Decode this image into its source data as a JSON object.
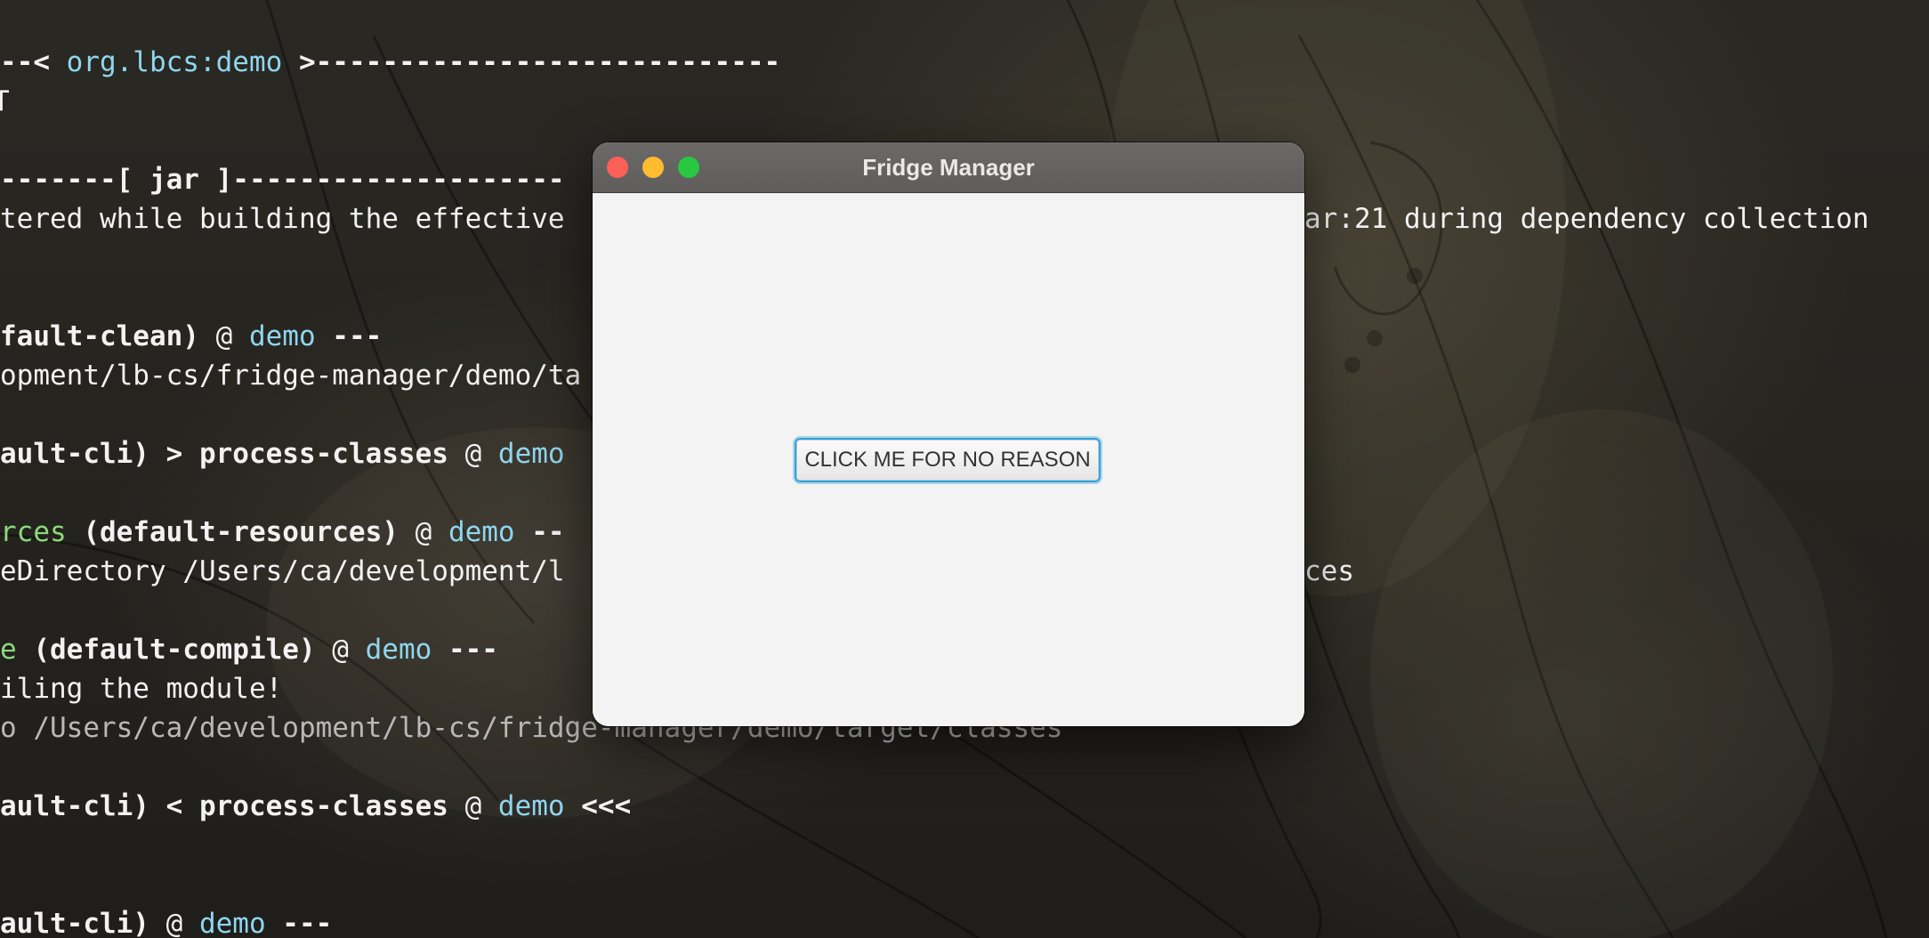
{
  "window": {
    "title": "Fridge Manager",
    "button_label": "CLICK ME FOR NO REASON"
  },
  "terminal": {
    "lines": [
      {
        "segments": [
          {
            "text": "--< ",
            "style": "b"
          },
          {
            "text": "org.lbcs:demo",
            "style": "cyan"
          },
          {
            "text": " >----------------------------",
            "style": "b"
          }
        ]
      },
      {
        "segments": [
          {
            "text": "T",
            "style": ""
          }
        ]
      },
      {
        "segments": [
          {
            "text": "-------[ jar ]--------------------",
            "style": "b"
          }
        ]
      },
      {
        "segments": [
          {
            "text": "tered while building the effective",
            "style": ""
          }
        ]
      },
      {
        "segments": [
          {
            "text": "ar:21 during dependency collection",
            "style": ""
          }
        ]
      },
      {
        "segments": [
          {
            "text": "fault-clean)",
            "style": "b"
          },
          {
            "text": " @ ",
            "style": ""
          },
          {
            "text": "demo",
            "style": "cyan"
          },
          {
            "text": " ---",
            "style": "b"
          }
        ]
      },
      {
        "segments": [
          {
            "text": "opment/lb-cs/fridge-manager/demo/ta",
            "style": ""
          }
        ]
      },
      {
        "segments": [
          {
            "text": "ault-cli) > process-classes",
            "style": "b"
          },
          {
            "text": " @ ",
            "style": ""
          },
          {
            "text": "demo",
            "style": "cyan"
          }
        ]
      },
      {
        "segments": [
          {
            "text": "rces",
            "style": "green"
          },
          {
            "text": " (default-resources)",
            "style": "b"
          },
          {
            "text": " @ ",
            "style": ""
          },
          {
            "text": "demo",
            "style": "cyan"
          },
          {
            "text": " --",
            "style": "b"
          }
        ]
      },
      {
        "segments": [
          {
            "text": "eDirectory /Users/ca/development/l",
            "style": ""
          }
        ]
      },
      {
        "segments": [
          {
            "text": "ces",
            "style": ""
          }
        ]
      },
      {
        "segments": [
          {
            "text": "e",
            "style": "green"
          },
          {
            "text": " (default-compile)",
            "style": "b"
          },
          {
            "text": " @ ",
            "style": ""
          },
          {
            "text": "demo",
            "style": "cyan"
          },
          {
            "text": " ---",
            "style": "b"
          }
        ]
      },
      {
        "segments": [
          {
            "text": "iling the module!",
            "style": ""
          }
        ]
      },
      {
        "segments": [
          {
            "text": "o /Users/ca/development/lb-cs/fridge-manager/demo/target/classes",
            "style": "dim"
          }
        ]
      },
      {
        "segments": [
          {
            "text": "ault-cli) < process-classes",
            "style": "b"
          },
          {
            "text": " @ ",
            "style": ""
          },
          {
            "text": "demo",
            "style": "cyan"
          },
          {
            "text": " <<<",
            "style": "b"
          }
        ]
      },
      {
        "segments": [
          {
            "text": "ault-cli)",
            "style": "b"
          },
          {
            "text": " @ ",
            "style": ""
          },
          {
            "text": "demo",
            "style": "cyan"
          },
          {
            "text": " ---",
            "style": "b"
          }
        ]
      }
    ]
  }
}
